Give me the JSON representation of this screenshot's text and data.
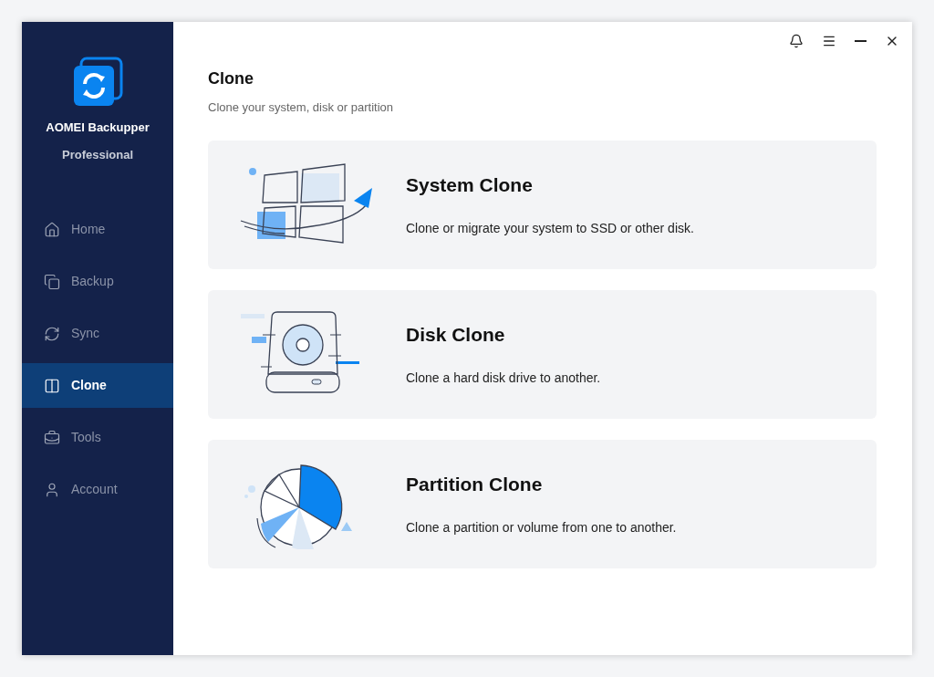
{
  "app": {
    "name": "AOMEI Backupper",
    "edition": "Professional"
  },
  "sidebar": {
    "items": [
      {
        "label": "Home",
        "selected": false
      },
      {
        "label": "Backup",
        "selected": false
      },
      {
        "label": "Sync",
        "selected": false
      },
      {
        "label": "Clone",
        "selected": true
      },
      {
        "label": "Tools",
        "selected": false
      },
      {
        "label": "Account",
        "selected": false
      }
    ]
  },
  "page": {
    "title": "Clone",
    "subtitle": "Clone your system, disk or partition"
  },
  "cards": [
    {
      "title": "System Clone",
      "description": "Clone or migrate your system to SSD or other disk."
    },
    {
      "title": "Disk Clone",
      "description": "Clone a hard disk drive to another."
    },
    {
      "title": "Partition Clone",
      "description": "Clone a partition or volume from one to another."
    }
  ]
}
